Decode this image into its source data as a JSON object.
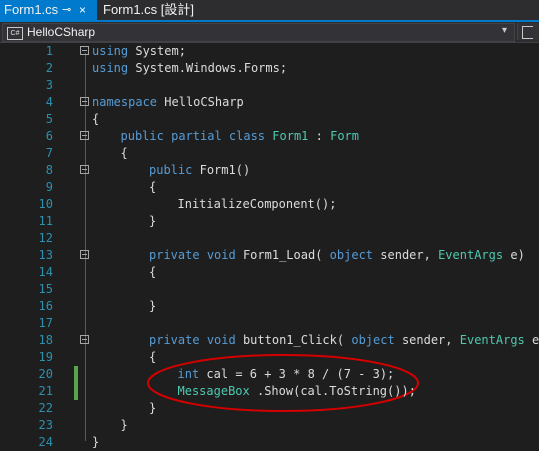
{
  "tabs": [
    {
      "label": "Form1.cs",
      "pin": "⊸",
      "close": "×"
    },
    {
      "label": "Form1.cs [設計]"
    }
  ],
  "navbar": {
    "label": "HelloCSharp",
    "icon": "C#"
  },
  "colors": {
    "accent": "#007acc",
    "keyword": "#569cd6",
    "type": "#4ec9b0",
    "line_number": "#2b91af",
    "changed_marker": "#57a64a",
    "annotation": "#d40000"
  },
  "code": [
    {
      "n": "1",
      "tokens": [
        [
          "kw",
          "using"
        ],
        [
          "",
          "System;"
        ]
      ],
      "indent": 0
    },
    {
      "n": "2",
      "tokens": [
        [
          "kw",
          "using"
        ],
        [
          "",
          "System.Windows.Forms;"
        ]
      ],
      "indent": 0
    },
    {
      "n": "3",
      "tokens": [],
      "indent": 0
    },
    {
      "n": "4",
      "tokens": [
        [
          "kw",
          "namespace"
        ],
        [
          "",
          "HelloCSharp"
        ]
      ],
      "indent": 0
    },
    {
      "n": "5",
      "tokens": [
        [
          "",
          "{"
        ]
      ],
      "indent": 0
    },
    {
      "n": "6",
      "tokens": [
        [
          "kw",
          "public"
        ],
        [
          "kw",
          "partial"
        ],
        [
          "kw",
          "class"
        ],
        [
          "ty",
          "Form1"
        ],
        [
          "",
          ":"
        ],
        [
          "ty",
          "Form"
        ]
      ],
      "indent": 1
    },
    {
      "n": "7",
      "tokens": [
        [
          "",
          "{"
        ]
      ],
      "indent": 1
    },
    {
      "n": "8",
      "tokens": [
        [
          "kw",
          "public"
        ],
        [
          "",
          "Form1()"
        ]
      ],
      "indent": 2
    },
    {
      "n": "9",
      "tokens": [
        [
          "",
          "{"
        ]
      ],
      "indent": 2
    },
    {
      "n": "10",
      "tokens": [
        [
          "",
          "InitializeComponent();"
        ]
      ],
      "indent": 3
    },
    {
      "n": "11",
      "tokens": [
        [
          "",
          "}"
        ]
      ],
      "indent": 2
    },
    {
      "n": "12",
      "tokens": [],
      "indent": 0
    },
    {
      "n": "13",
      "tokens": [
        [
          "kw",
          "private"
        ],
        [
          "kw",
          "void"
        ],
        [
          "",
          "Form1_Load("
        ],
        [
          "kw",
          "object"
        ],
        [
          "",
          "sender,"
        ],
        [
          "ty",
          "EventArgs"
        ],
        [
          "",
          "e)"
        ]
      ],
      "indent": 2
    },
    {
      "n": "14",
      "tokens": [
        [
          "",
          "{"
        ]
      ],
      "indent": 2
    },
    {
      "n": "15",
      "tokens": [],
      "indent": 0
    },
    {
      "n": "16",
      "tokens": [
        [
          "",
          "}"
        ]
      ],
      "indent": 2
    },
    {
      "n": "17",
      "tokens": [],
      "indent": 0
    },
    {
      "n": "18",
      "tokens": [
        [
          "kw",
          "private"
        ],
        [
          "kw",
          "void"
        ],
        [
          "",
          "button1_Click("
        ],
        [
          "kw",
          "object"
        ],
        [
          "",
          "sender,"
        ],
        [
          "ty",
          "EventArgs"
        ],
        [
          "",
          "e)"
        ]
      ],
      "indent": 2
    },
    {
      "n": "19",
      "tokens": [
        [
          "",
          "{"
        ]
      ],
      "indent": 2
    },
    {
      "n": "20",
      "tokens": [
        [
          "kw",
          "int"
        ],
        [
          "",
          "cal = 6 + 3 * 8 / (7 - 3);"
        ]
      ],
      "indent": 3
    },
    {
      "n": "21",
      "tokens": [
        [
          "ty",
          "MessageBox"
        ],
        [
          "",
          ".Show(cal.ToString());"
        ]
      ],
      "indent": 3
    },
    {
      "n": "22",
      "tokens": [
        [
          "",
          "}"
        ]
      ],
      "indent": 2
    },
    {
      "n": "23",
      "tokens": [
        [
          "",
          "}"
        ]
      ],
      "indent": 1
    },
    {
      "n": "24",
      "tokens": [
        [
          "",
          "}"
        ]
      ],
      "indent": 0
    }
  ]
}
